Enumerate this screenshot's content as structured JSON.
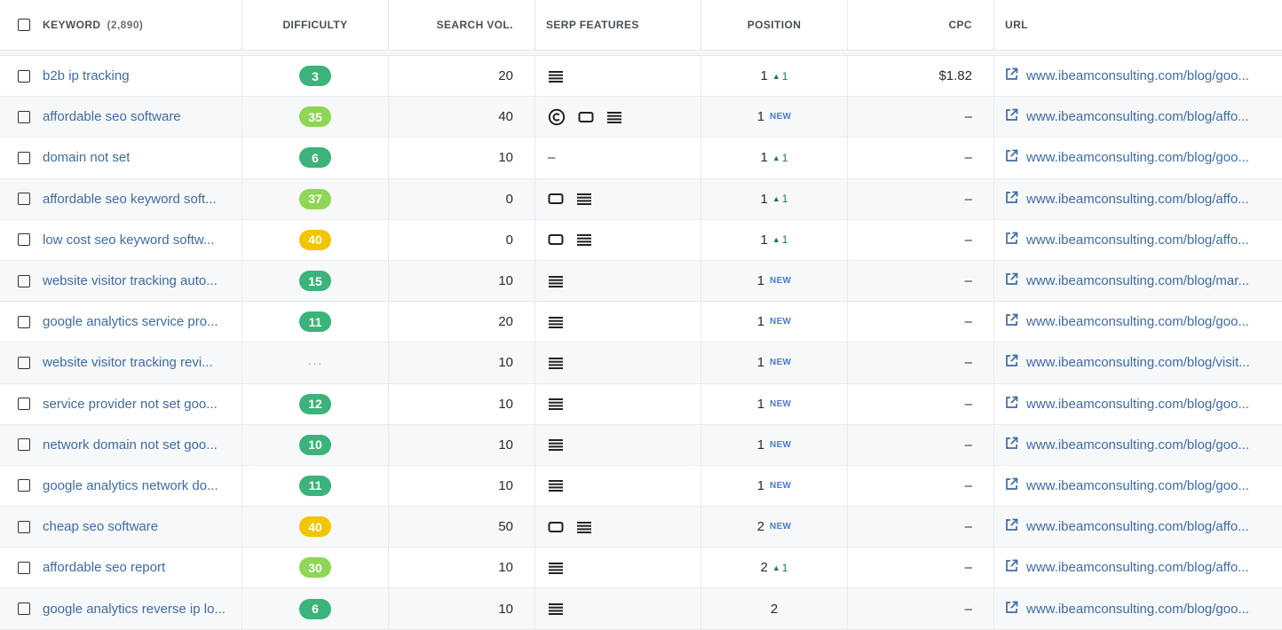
{
  "header": {
    "keyword": "KEYWORD",
    "keyword_count": "(2,890)",
    "difficulty": "DIFFICULTY",
    "search_vol": "SEARCH VOL.",
    "serp_features": "SERP FEATURES",
    "position": "POSITION",
    "cpc": "CPC",
    "url": "URL"
  },
  "colors": {
    "kd_dark_green": "#3bb37a",
    "kd_light_green": "#8ed655",
    "kd_yellow": "#f2c500",
    "link_blue": "#3e6ba5",
    "trend_green": "#1f7a3a",
    "new_blue": "#4a7bd1"
  },
  "rows": [
    {
      "keyword": "b2b ip tracking",
      "difficulty": "3",
      "kd_color": "#3bb37a",
      "volume": "20",
      "serp": [
        "list-icon"
      ],
      "position": "1",
      "change": "1",
      "is_new": false,
      "cpc": "$1.82",
      "url": "www.ibeamconsulting.com/blog/goo..."
    },
    {
      "keyword": "affordable seo software",
      "difficulty": "35",
      "kd_color": "#8ed655",
      "volume": "40",
      "serp": [
        "copyright-icon",
        "snippet-icon",
        "list-icon"
      ],
      "position": "1",
      "change": "",
      "is_new": true,
      "cpc": "–",
      "url": "www.ibeamconsulting.com/blog/affo..."
    },
    {
      "keyword": "domain not set",
      "difficulty": "6",
      "kd_color": "#3bb37a",
      "volume": "10",
      "serp": [],
      "serp_text": "–",
      "position": "1",
      "change": "1",
      "is_new": false,
      "cpc": "–",
      "url": "www.ibeamconsulting.com/blog/goo..."
    },
    {
      "keyword": "affordable seo keyword soft...",
      "difficulty": "37",
      "kd_color": "#8ed655",
      "volume": "0",
      "serp": [
        "snippet-icon",
        "list-icon"
      ],
      "position": "1",
      "change": "1",
      "is_new": false,
      "cpc": "–",
      "url": "www.ibeamconsulting.com/blog/affo..."
    },
    {
      "keyword": "low cost seo keyword softw...",
      "difficulty": "40",
      "kd_color": "#f2c500",
      "volume": "0",
      "serp": [
        "snippet-icon",
        "list-icon"
      ],
      "position": "1",
      "change": "1",
      "is_new": false,
      "cpc": "–",
      "url": "www.ibeamconsulting.com/blog/affo..."
    },
    {
      "keyword": "website visitor tracking auto...",
      "difficulty": "15",
      "kd_color": "#3bb37a",
      "volume": "10",
      "serp": [
        "list-icon"
      ],
      "position": "1",
      "change": "",
      "is_new": true,
      "cpc": "–",
      "url": "www.ibeamconsulting.com/blog/mar..."
    },
    {
      "keyword": "google analytics service pro...",
      "difficulty": "11",
      "kd_color": "#3bb37a",
      "volume": "20",
      "serp": [
        "list-icon"
      ],
      "position": "1",
      "change": "",
      "is_new": true,
      "cpc": "–",
      "url": "www.ibeamconsulting.com/blog/goo..."
    },
    {
      "keyword": "website visitor tracking revi...",
      "difficulty": "···",
      "kd_color": "",
      "volume": "10",
      "serp": [
        "list-icon"
      ],
      "position": "1",
      "change": "",
      "is_new": true,
      "cpc": "–",
      "url": "www.ibeamconsulting.com/blog/visit..."
    },
    {
      "keyword": "service provider not set goo...",
      "difficulty": "12",
      "kd_color": "#3bb37a",
      "volume": "10",
      "serp": [
        "list-icon"
      ],
      "position": "1",
      "change": "",
      "is_new": true,
      "cpc": "–",
      "url": "www.ibeamconsulting.com/blog/goo..."
    },
    {
      "keyword": "network domain not set goo...",
      "difficulty": "10",
      "kd_color": "#3bb37a",
      "volume": "10",
      "serp": [
        "list-icon"
      ],
      "position": "1",
      "change": "",
      "is_new": true,
      "cpc": "–",
      "url": "www.ibeamconsulting.com/blog/goo..."
    },
    {
      "keyword": "google analytics network do...",
      "difficulty": "11",
      "kd_color": "#3bb37a",
      "volume": "10",
      "serp": [
        "list-icon"
      ],
      "position": "1",
      "change": "",
      "is_new": true,
      "cpc": "–",
      "url": "www.ibeamconsulting.com/blog/goo..."
    },
    {
      "keyword": "cheap seo software",
      "difficulty": "40",
      "kd_color": "#f2c500",
      "volume": "50",
      "serp": [
        "snippet-icon",
        "list-icon"
      ],
      "position": "2",
      "change": "",
      "is_new": true,
      "cpc": "–",
      "url": "www.ibeamconsulting.com/blog/affo..."
    },
    {
      "keyword": "affordable seo report",
      "difficulty": "30",
      "kd_color": "#8ed655",
      "volume": "10",
      "serp": [
        "list-icon"
      ],
      "position": "2",
      "change": "1",
      "is_new": false,
      "cpc": "–",
      "url": "www.ibeamconsulting.com/blog/affo..."
    },
    {
      "keyword": "google analytics reverse ip lo...",
      "difficulty": "6",
      "kd_color": "#3bb37a",
      "volume": "10",
      "serp": [
        "list-icon"
      ],
      "position": "2",
      "change": "",
      "is_new": false,
      "cpc": "–",
      "url": "www.ibeamconsulting.com/blog/goo..."
    }
  ],
  "labels": {
    "new": "NEW"
  }
}
